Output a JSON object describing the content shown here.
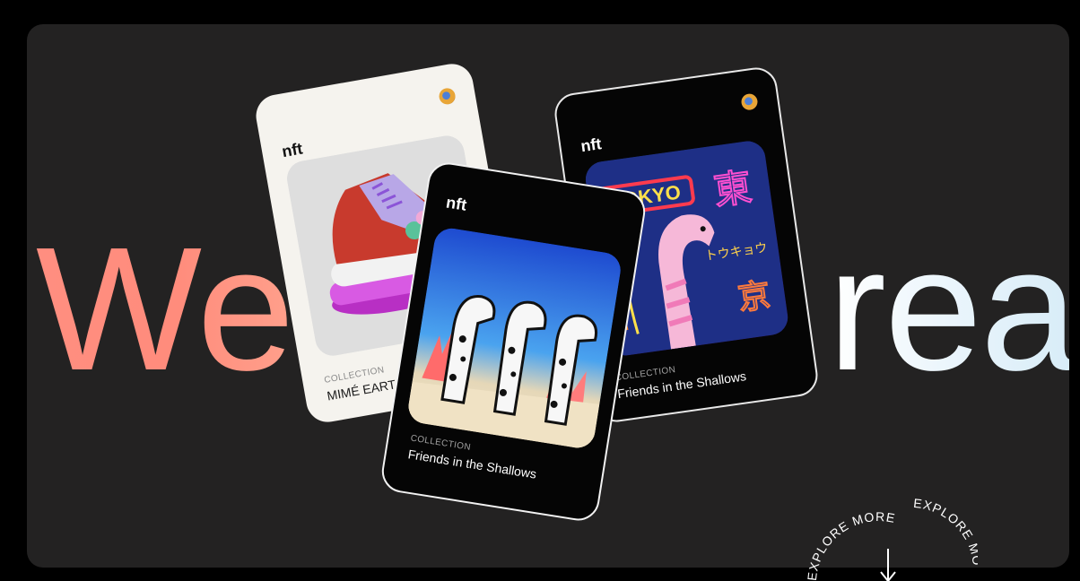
{
  "hero": {
    "left_text": "Web",
    "right_text": "rea"
  },
  "cards": [
    {
      "brand": "nft",
      "label": "COLLECTION",
      "name": "MIMÉ EART",
      "avatar": "avatar-icon",
      "art": "sneaker-art"
    },
    {
      "brand": "nft",
      "label": "COLLECTION",
      "name": "Friends in the Shallows",
      "avatar": "avatar-icon",
      "art": "tokyo-eel-art",
      "art_text": {
        "sign_main": "TOKYO",
        "kanji_top": "東",
        "kanji_right": "京",
        "kana": "トウキョウ"
      }
    },
    {
      "brand": "nft",
      "label": "COLLECTION",
      "name": "Friends in the Shallows",
      "art": "garden-eels-art"
    }
  ],
  "explore": {
    "text": "EXPLORE MORE",
    "text2": "EXPLORE MO"
  },
  "colors": {
    "background": "#000000",
    "panel": "#232222",
    "hero_left": "#ff8e80",
    "hero_right": "#e6f3fb"
  }
}
